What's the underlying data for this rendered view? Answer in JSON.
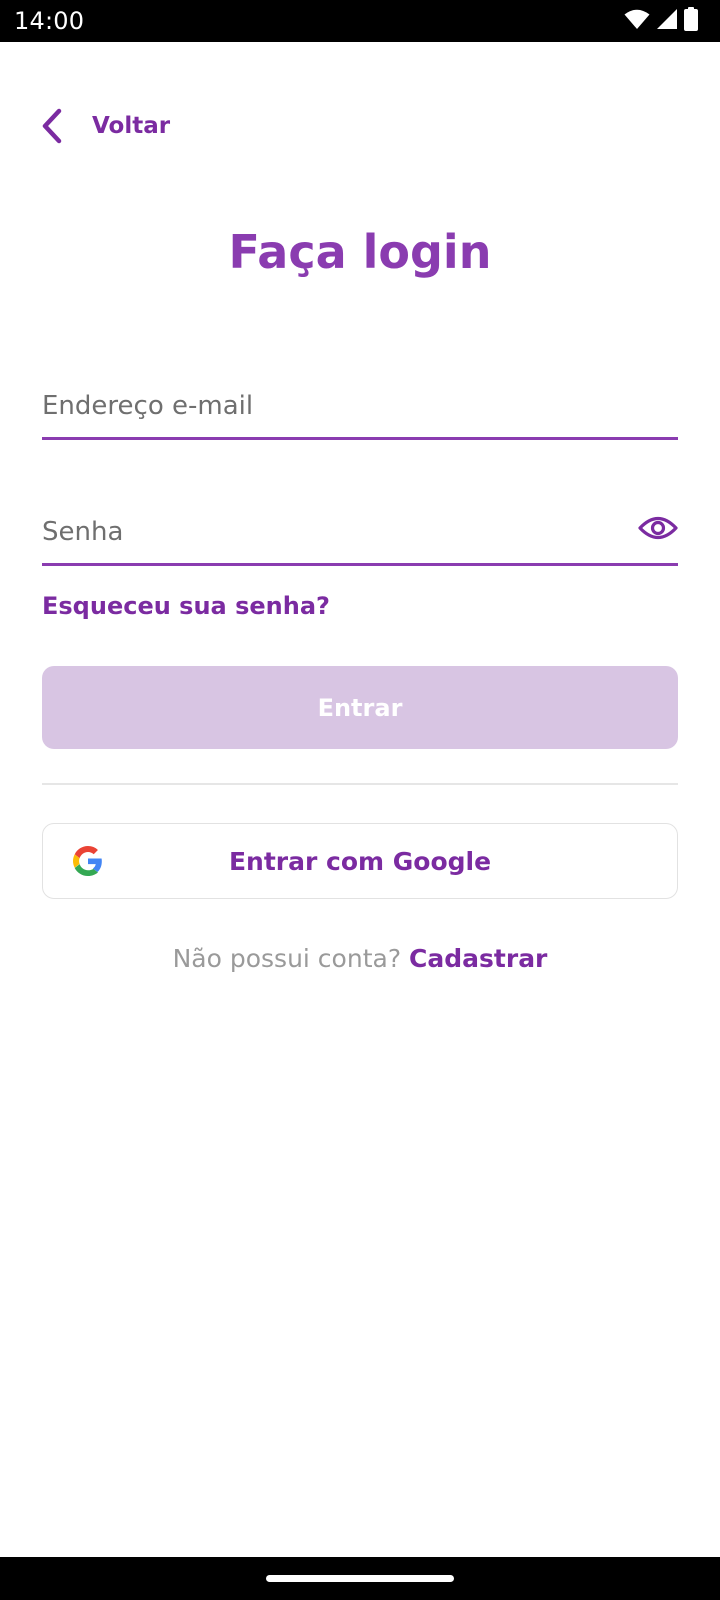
{
  "status_bar": {
    "time": "14:00",
    "icons": [
      "wifi-icon",
      "signal-icon",
      "battery-icon"
    ]
  },
  "header": {
    "back_label": "Voltar"
  },
  "title": "Faça login",
  "form": {
    "email_placeholder": "Endereço e-mail",
    "email_value": "",
    "password_placeholder": "Senha",
    "password_value": "",
    "forgot_password": "Esqueceu sua senha?",
    "submit_label": "Entrar",
    "google_label": "Entrar com Google"
  },
  "signup": {
    "prompt": "Não possui conta?",
    "link": "Cadastrar"
  },
  "colors": {
    "primary": "#7B2BA1",
    "title": "#8A3CB0",
    "disabled_button": "#D8C5E3",
    "muted_text": "#9a9a9a"
  }
}
